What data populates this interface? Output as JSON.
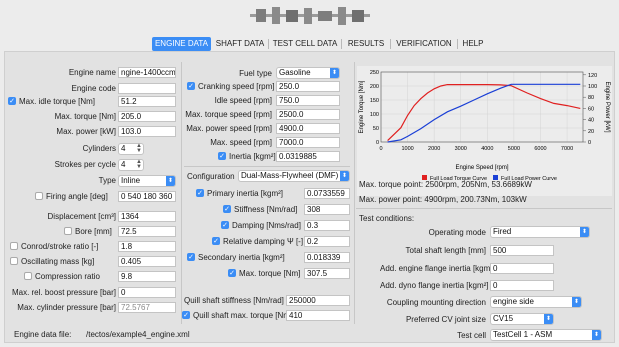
{
  "tabs": [
    {
      "label": "ENGINE DATA",
      "active": true
    },
    {
      "label": "SHAFT DATA",
      "active": false
    },
    {
      "label": "TEST CELL DATA",
      "active": false
    },
    {
      "label": "RESULTS",
      "active": false
    },
    {
      "label": "VERIFICATION",
      "active": false
    },
    {
      "label": "HELP",
      "active": false
    }
  ],
  "engine": {
    "name_label": "Engine name",
    "name_value": "ngine-1400ccm",
    "code_label": "Engine code",
    "code_value": "",
    "idle_torque_label": "Max. idle torque [Nm]",
    "idle_torque_value": "51.2",
    "idle_torque_checked": true,
    "max_torque_label": "Max. torque [Nm]",
    "max_torque_value": "205.0",
    "max_power_label": "Max. power [kW]",
    "max_power_value": "103.0",
    "cylinders_label": "Cylinders",
    "cylinders_value": "4",
    "strokes_label": "Strokes per cycle",
    "strokes_value": "4",
    "type_label": "Type",
    "type_value": "Inline",
    "firing_label": "Firing angle [deg]",
    "firing_value": "0 540 180 360",
    "firing_checked": false,
    "displacement_label": "Displacement [cm³]",
    "displacement_value": "1364",
    "bore_label": "Bore [mm]",
    "bore_value": "72.5",
    "bore_checked": false,
    "conrod_label": "Conrod/stroke ratio [-]",
    "conrod_value": "1.8",
    "conrod_checked": false,
    "osc_label": "Oscillating mass [kg]",
    "osc_value": "0.405",
    "osc_checked": false,
    "comp_label": "Compression ratio",
    "comp_value": "9.8",
    "comp_checked": false,
    "boost_label": "Max. rel. boost pressure [bar]",
    "boost_value": "0",
    "cyl_pressure_label": "Max. cylinder pressure [bar]",
    "cyl_pressure_value": "72.5767"
  },
  "middle": {
    "fuel_label": "Fuel type",
    "fuel_value": "Gasoline",
    "cranking_label": "Cranking speed [rpm]",
    "cranking_value": "250.0",
    "cranking_checked": true,
    "idle_label": "Idle speed [rpm]",
    "idle_value": "750.0",
    "mt_speed_label": "Max. torque speed [rpm]",
    "mt_speed_value": "2500.0",
    "mp_speed_label": "Max. power speed [rpm]",
    "mp_speed_value": "4900.0",
    "max_speed_label": "Max. speed [rpm]",
    "max_speed_value": "7000.0",
    "inertia_label": "Inertia [kgm²]",
    "inertia_value": "0.0319885",
    "inertia_checked": true,
    "config_label": "Configuration",
    "config_value": "Dual-Mass-Flywheel (DMF)",
    "prim_label": "Primary inertia [kgm²]",
    "prim_value": "0.0733559",
    "prim_checked": true,
    "stiff_label": "Stiffness [Nm/rad]",
    "stiff_value": "308",
    "stiff_checked": true,
    "damp_label": "Damping [Nms/rad]",
    "damp_value": "0.3",
    "damp_checked": true,
    "reldamp_label": "Relative damping Ψ [-]",
    "reldamp_value": "0.2",
    "reldamp_checked": true,
    "sec_label": "Secondary inertia [kgm²]",
    "sec_value": "0.018339",
    "sec_checked": true,
    "dmf_torque_label": "Max. torque [Nm]",
    "dmf_torque_value": "307.5",
    "dmf_torque_checked": true,
    "quill_stiff_label": "Quill shaft stiffness [Nm/rad]",
    "quill_stiff_value": "250000",
    "quill_torque_label": "Quill shaft max. torque [Nm]",
    "quill_torque_value": "410",
    "quill_torque_checked": true
  },
  "footer": {
    "datafile_label": "Engine data file:",
    "datafile_value": "/tectos/example4_engine.xml"
  },
  "summary": {
    "torque_point": "Max. torque point: 2500rpm, 205Nm, 53.6689kW",
    "power_point": "Max. power point: 4900rpm, 200.73Nm, 103kW"
  },
  "test": {
    "heading": "Test conditions:",
    "mode_label": "Operating mode",
    "mode_value": "Fired",
    "shaft_len_label": "Total shaft length [mm]",
    "shaft_len_value": "500",
    "eng_flange_label": "Add. engine flange inertia [kgm²]",
    "eng_flange_value": "0",
    "dyno_flange_label": "Add. dyno flange inertia [kgm²]",
    "dyno_flange_value": "0",
    "coupling_label": "Coupling mounting direction",
    "coupling_value": "engine side",
    "cv_label": "Preferred CV joint size",
    "cv_value": "CV15",
    "cell_label": "Test cell",
    "cell_value": "TestCell 1 - ASM"
  },
  "chart_data": {
    "type": "line",
    "xlabel": "Engine Speed [rpm]",
    "ylabel": "Engine Torque [Nm]",
    "y2label": "Engine Power [kW]",
    "xlim": [
      0,
      7600
    ],
    "ylim": [
      0,
      250
    ],
    "y2lim": [
      0,
      125
    ],
    "xticks": [
      "0",
      "1000",
      "2000",
      "3000",
      "4000",
      "5000",
      "6000",
      "7000"
    ],
    "yticks": [
      "0",
      "50",
      "100",
      "150",
      "200",
      "250"
    ],
    "y2ticks": [
      "0",
      "20",
      "40",
      "60",
      "80",
      "100",
      "120"
    ],
    "legend_position": "bottom",
    "series": [
      {
        "name": "Full Load Torque Curve",
        "color": "#e02020",
        "axis": "left",
        "x": [
          250,
          750,
          1000,
          1250,
          1500,
          1750,
          2000,
          2250,
          2500,
          3000,
          3500,
          4000,
          4500,
          4900,
          5500,
          6000,
          6500,
          7000,
          7500
        ],
        "y": [
          5,
          51,
          95,
          130,
          155,
          175,
          190,
          200,
          205,
          205,
          205,
          205,
          204,
          201,
          175,
          155,
          138,
          130,
          120
        ]
      },
      {
        "name": "Full Load Power Curve",
        "color": "#1a3fd6",
        "axis": "right",
        "x": [
          250,
          750,
          1000,
          1500,
          2000,
          2500,
          3000,
          3500,
          4000,
          4500,
          4900,
          5500,
          6000,
          6500,
          7000,
          7500
        ],
        "y": [
          0,
          4,
          10,
          24,
          40,
          54,
          64,
          75,
          86,
          96,
          103,
          103,
          103,
          103,
          103,
          103
        ]
      }
    ]
  }
}
